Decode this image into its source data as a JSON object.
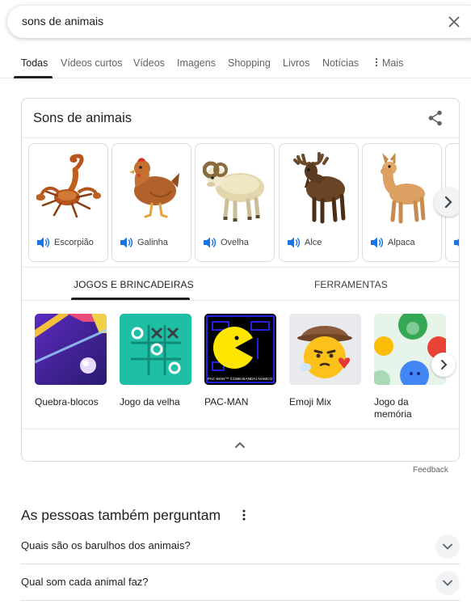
{
  "search": {
    "query": "sons de animais"
  },
  "tabs": [
    {
      "label": "Todas"
    },
    {
      "label": "Vídeos curtos"
    },
    {
      "label": "Vídeos"
    },
    {
      "label": "Imagens"
    },
    {
      "label": "Shopping"
    },
    {
      "label": "Livros"
    },
    {
      "label": "Notícias"
    },
    {
      "label": "Mais"
    }
  ],
  "card": {
    "title": "Sons de animais",
    "animals": [
      {
        "label": "Escorpião",
        "icon": "scorpion-icon"
      },
      {
        "label": "Galinha",
        "icon": "chicken-icon"
      },
      {
        "label": "Ovelha",
        "icon": "sheep-icon"
      },
      {
        "label": "Alce",
        "icon": "moose-icon"
      },
      {
        "label": "Alpaca",
        "icon": "alpaca-icon"
      }
    ],
    "sub_tabs": {
      "active": "JOGOS E BRINCADEIRAS",
      "inactive": "FERRAMENTAS"
    },
    "games": [
      {
        "label": "Quebra-blocos"
      },
      {
        "label": "Jogo da velha"
      },
      {
        "label": "PAC-MAN",
        "thumb_caption": "PAC-MAN™ ©1980 BANDAI NAMCO"
      },
      {
        "label": "Emoji Mix"
      },
      {
        "label": "Jogo da memória"
      }
    ]
  },
  "feedback": "Feedback",
  "paa": {
    "title": "As pessoas também perguntam",
    "questions": [
      {
        "text": "Quais são os barulhos dos animais?"
      },
      {
        "text": "Qual som cada animal faz?"
      }
    ]
  },
  "colors": {
    "accent": "#1a73e8",
    "text": "#202124",
    "muted": "#5f6368",
    "border": "#dadce0"
  }
}
